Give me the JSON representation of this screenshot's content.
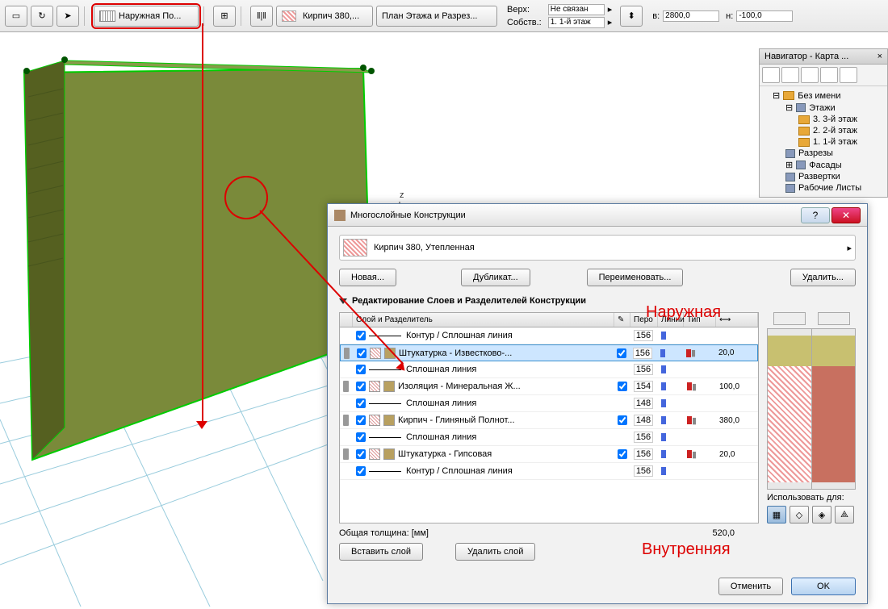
{
  "toolbar": {
    "outer_surface": "Наружная По...",
    "brick_380": "Кирпич 380,...",
    "floor_plan": "План Этажа и Разрез...",
    "top_label": "Верх:",
    "top_val": "Не связан",
    "own_label": "Собств.:",
    "own_val": "1. 1-й этаж",
    "w_label": "в:",
    "w_val": "2800,0",
    "h_label": "н:",
    "h_val": "-100,0"
  },
  "navigator": {
    "title": "Навигатор - Карта ...",
    "root": "Без имени",
    "floors": "Этажи",
    "floor3": "3. 3-й этаж",
    "floor2": "2. 2-й этаж",
    "floor1": "1. 1-й этаж",
    "sections": "Разрезы",
    "facades": "Фасады",
    "unfolds": "Развертки",
    "worksheets": "Рабочие Листы"
  },
  "dialog": {
    "title": "Многослойные Конструкции",
    "composite_name": "Кирпич 380, Утепленная",
    "btn_new": "Новая...",
    "btn_dup": "Дубликат...",
    "btn_ren": "Переименовать...",
    "btn_del": "Удалить...",
    "section": "Редактирование Слоев и Разделителей Конструкции",
    "col_layer": "Слой и Разделитель",
    "col_pen": "Перо",
    "col_line": "Линии",
    "col_type": "Тип",
    "total_label": "Общая толщина: [мм]",
    "total_val": "520,0",
    "btn_insert": "Вставить слой",
    "btn_remove": "Удалить слой",
    "use_for": "Использовать для:",
    "btn_cancel": "Отменить",
    "btn_ok": "OK",
    "layers": [
      {
        "name": "Контур / Сплошная линия",
        "pen": "156",
        "thick": ""
      },
      {
        "name": "Штукатурка - Известково-...",
        "pen": "156",
        "thick": "20,0",
        "sel": true
      },
      {
        "name": "Сплошная линия",
        "pen": "156",
        "thick": ""
      },
      {
        "name": "Изоляция - Минеральная Ж...",
        "pen": "154",
        "thick": "100,0"
      },
      {
        "name": "Сплошная линия",
        "pen": "148",
        "thick": ""
      },
      {
        "name": "Кирпич - Глиняный Полнот...",
        "pen": "148",
        "thick": "380,0"
      },
      {
        "name": "Сплошная линия",
        "pen": "156",
        "thick": ""
      },
      {
        "name": "Штукатурка - Гипсовая",
        "pen": "156",
        "thick": "20,0"
      },
      {
        "name": "Контур / Сплошная линия",
        "pen": "156",
        "thick": ""
      }
    ]
  },
  "annotations": {
    "outer": "Наружная",
    "inner": "Внутренняя"
  }
}
